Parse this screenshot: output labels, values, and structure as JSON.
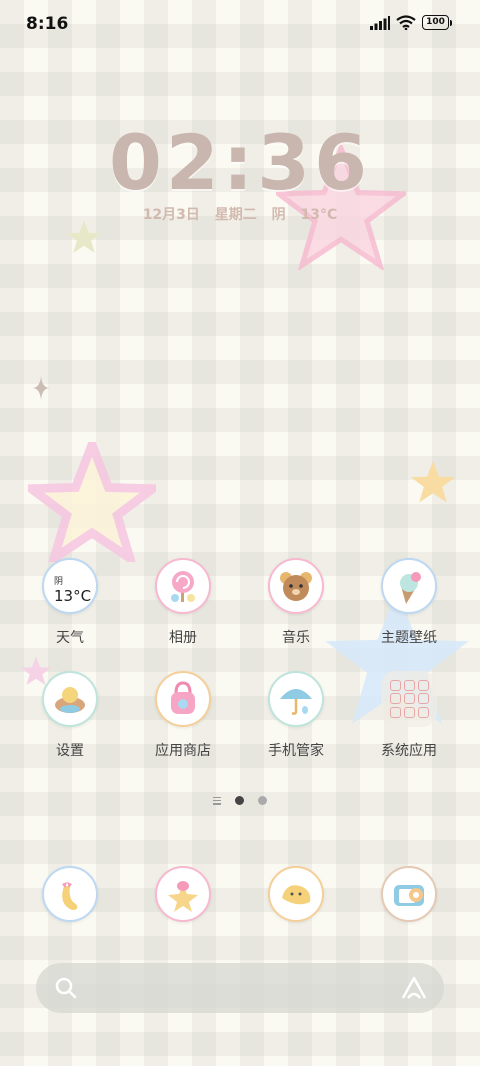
{
  "status_bar": {
    "time": "8:16",
    "battery": "100"
  },
  "clock_widget": {
    "time": "02:36",
    "date": "12月3日",
    "weekday": "星期二",
    "weather": "阴",
    "temp": "13°C"
  },
  "apps": [
    {
      "id": "weather",
      "label": "天气",
      "condition": "阴",
      "temp": "13°C"
    },
    {
      "id": "gallery",
      "label": "相册"
    },
    {
      "id": "music",
      "label": "音乐"
    },
    {
      "id": "themes",
      "label": "主题壁纸"
    },
    {
      "id": "settings",
      "label": "设置"
    },
    {
      "id": "appstore",
      "label": "应用商店"
    },
    {
      "id": "security",
      "label": "手机管家"
    },
    {
      "id": "system",
      "label": "系统应用"
    }
  ],
  "dock": [
    {
      "id": "phone",
      "icon": "banana-icon"
    },
    {
      "id": "messages",
      "icon": "cake-star-icon"
    },
    {
      "id": "browser",
      "icon": "bread-icon"
    },
    {
      "id": "camera",
      "icon": "camera-icon"
    }
  ],
  "pager": {
    "pages": 2,
    "current": 1
  },
  "colors": {
    "pink": "#f5c2d8",
    "blue": "#c8ddf5",
    "yellow": "#f5d89a",
    "clock": "#c9b6ae"
  }
}
